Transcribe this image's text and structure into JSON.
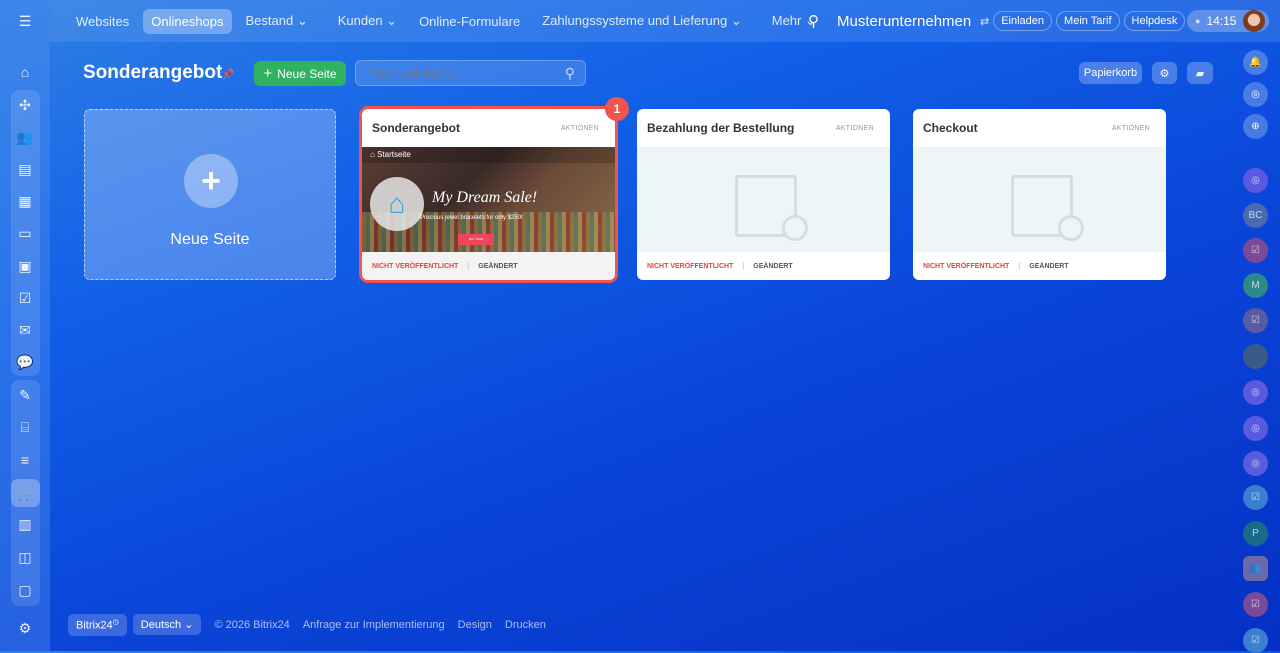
{
  "topbar": {
    "nav": [
      {
        "label": "Websites"
      },
      {
        "label": "Onlineshops",
        "selected": true
      },
      {
        "label": "Bestand ⌄"
      },
      {
        "label": "Kunden ⌄"
      },
      {
        "label": "Online-Formulare"
      },
      {
        "label": "Zahlungssysteme und Lieferung ⌄"
      },
      {
        "label": "Mehr ⌄"
      }
    ],
    "company": "Musterunternehmen",
    "invite": "Einladen",
    "tariff": "Mein Tarif",
    "helpdesk": "Helpdesk",
    "time": "14:15"
  },
  "page": {
    "title": "Sonderangebot",
    "new_page_button": "Neue Seite",
    "search_placeholder": "Filter und Suche",
    "trash": "Papierkorb"
  },
  "new_card": {
    "label": "Neue Seite"
  },
  "cards": [
    {
      "title": "Sonderangebot",
      "actions": "AKTIONEN",
      "status": "NICHT VERÖFFENTLICHT",
      "changed": "GEÄNDERT",
      "badge": "1",
      "preview": {
        "breadcrumb": "Startseite",
        "headline": "My Dream Sale!",
        "subtitle": "Precious jewel bracelets for only $250!",
        "cta": "BUY NOW"
      }
    },
    {
      "title": "Bezahlung der Bestellung",
      "actions": "AKTIONEN",
      "status": "NICHT VERÖFFENTLICHT",
      "changed": "GEÄNDERT"
    },
    {
      "title": "Checkout",
      "actions": "AKTIONEN",
      "status": "NICHT VERÖFFENTLICHT",
      "changed": "GEÄNDERT"
    }
  ],
  "right_sidebar": {
    "initials": [
      "BC",
      "M",
      "P"
    ]
  },
  "footer": {
    "brand": "Bitrix24",
    "language": "Deutsch",
    "copyright": "© 2026 Bitrix24",
    "links": [
      "Anfrage zur Implementierung",
      "Design",
      "Drucken"
    ]
  },
  "colors": {
    "accent_green": "#2fb35f",
    "status_red": "#e0453a",
    "highlight": "#f0544a"
  }
}
